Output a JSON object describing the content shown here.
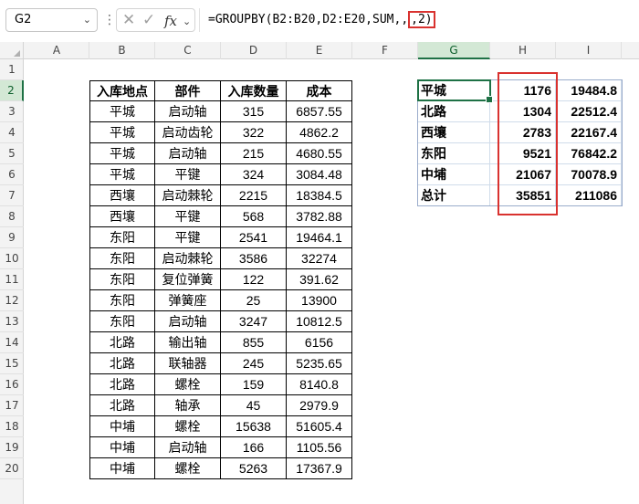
{
  "formula_bar": {
    "name_box": "G2",
    "name_box_chevron": "chevron-down-icon",
    "more_icon": "vertical-dots-icon",
    "cancel_icon": "cancel-x-icon",
    "enter_icon": "check-icon",
    "fx_label": "fx",
    "formula_prefix": "=GROUPBY(B2:B20,D2:E20,SUM,,",
    "formula_highlight": ",2)",
    "highlight_color": "#d9322f"
  },
  "columns": [
    "A",
    "B",
    "C",
    "D",
    "E",
    "F",
    "G",
    "H",
    "I"
  ],
  "selected_column": "G",
  "rows": [
    "1",
    "2",
    "3",
    "4",
    "5",
    "6",
    "7",
    "8",
    "9",
    "10",
    "11",
    "12",
    "13",
    "14",
    "15",
    "16",
    "17",
    "18",
    "19",
    "20"
  ],
  "selected_row": "2",
  "source_table": {
    "headers": [
      "入库地点",
      "部件",
      "入库数量",
      "成本"
    ],
    "rows": [
      [
        "平城",
        "启动轴",
        "315",
        "6857.55"
      ],
      [
        "平城",
        "启动齿轮",
        "322",
        "4862.2"
      ],
      [
        "平城",
        "启动轴",
        "215",
        "4680.55"
      ],
      [
        "平城",
        "平键",
        "324",
        "3084.48"
      ],
      [
        "西壤",
        "启动棘轮",
        "2215",
        "18384.5"
      ],
      [
        "西壤",
        "平键",
        "568",
        "3782.88"
      ],
      [
        "东阳",
        "平键",
        "2541",
        "19464.1"
      ],
      [
        "东阳",
        "启动棘轮",
        "3586",
        "32274"
      ],
      [
        "东阳",
        "复位弹簧",
        "122",
        "391.62"
      ],
      [
        "东阳",
        "弹簧座",
        "25",
        "13900"
      ],
      [
        "东阳",
        "启动轴",
        "3247",
        "10812.5"
      ],
      [
        "北路",
        "输出轴",
        "855",
        "6156"
      ],
      [
        "北路",
        "联轴器",
        "245",
        "5235.65"
      ],
      [
        "北路",
        "螺栓",
        "159",
        "8140.8"
      ],
      [
        "北路",
        "轴承",
        "45",
        "2979.9"
      ],
      [
        "中埔",
        "螺栓",
        "15638",
        "51605.4"
      ],
      [
        "中埔",
        "启动轴",
        "166",
        "1105.56"
      ],
      [
        "中埔",
        "螺栓",
        "5263",
        "17367.9"
      ]
    ]
  },
  "result_table": {
    "rows": [
      [
        "平城",
        "1176",
        "19484.8"
      ],
      [
        "北路",
        "1304",
        "22512.4"
      ],
      [
        "西壤",
        "2783",
        "22167.4"
      ],
      [
        "东阳",
        "9521",
        "76842.2"
      ],
      [
        "中埔",
        "21067",
        "70078.9"
      ],
      [
        "总计",
        "35851",
        "211086"
      ]
    ]
  }
}
